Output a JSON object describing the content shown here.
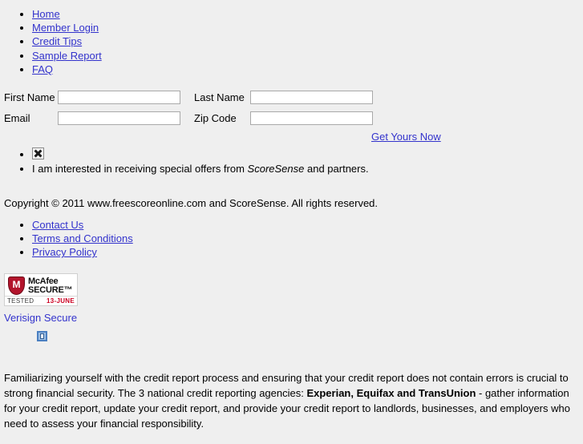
{
  "nav": {
    "items": [
      {
        "label": "Home"
      },
      {
        "label": "Member Login"
      },
      {
        "label": "Credit Tips"
      },
      {
        "label": "Sample Report"
      },
      {
        "label": "FAQ"
      }
    ]
  },
  "form": {
    "first_name_label": "First Name",
    "first_name_value": "",
    "last_name_label": "Last Name",
    "last_name_value": "",
    "email_label": "Email",
    "email_value": "",
    "zip_label": "Zip Code",
    "zip_value": "",
    "cta_label": "Get Yours Now"
  },
  "options": {
    "image_alt": "broken-image",
    "offers_text_pre": "I am interested in receiving special offers from ",
    "offers_brand": "ScoreSense",
    "offers_text_post": " and partners."
  },
  "copyright": {
    "text": "Copyright © 2011 www.freescoreonline.com and ScoreSense. All rights reserved."
  },
  "footer": {
    "items": [
      {
        "label": "Contact Us"
      },
      {
        "label": "Terms and Conditions"
      },
      {
        "label": "Privacy Policy"
      }
    ]
  },
  "badges": {
    "mcafee_line1": "McAfee",
    "mcafee_line2": "SECURE™",
    "mcafee_shield_letter": "M",
    "mcafee_tested": "TESTED",
    "mcafee_date": "13-JUNE",
    "verisign_label": "Verisign Secure"
  },
  "paragraph": {
    "part1": "Familiarizing yourself with the credit report process and ensuring that your credit report does not contain errors is crucial to strong financial security. The 3 national credit reporting agencies: ",
    "bold": "Experian, Equifax and TransUnion",
    "part2": " - gather information for your credit report, update your credit report, and provide your credit report to landlords, businesses, and employers who need to assess your financial responsibility."
  },
  "colors": {
    "background": "#efefef",
    "link": "#3333cc",
    "mcafee_red": "#b3142c",
    "date_red": "#cc0022"
  }
}
